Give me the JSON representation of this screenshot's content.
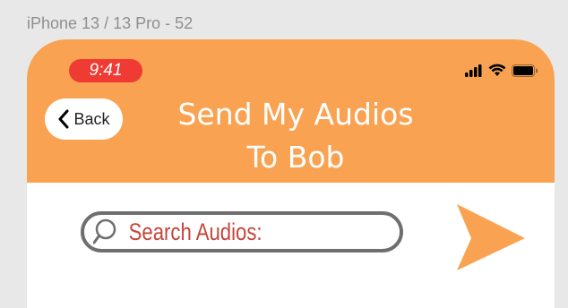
{
  "frame": {
    "label": "iPhone 13 / 13 Pro - 52"
  },
  "status_bar": {
    "time": "9:41",
    "icons": [
      "cellular-signal-icon",
      "wifi-icon",
      "battery-icon"
    ]
  },
  "header": {
    "back_label": "Back",
    "title_line1": "Send My Audios",
    "title_line2": "To Bob"
  },
  "search": {
    "placeholder": "Search Audios:",
    "value": ""
  },
  "colors": {
    "header_bg": "#f9a352",
    "time_pill": "#ef3b33",
    "send_icon": "#f9a352",
    "search_text": "#c4463a"
  }
}
